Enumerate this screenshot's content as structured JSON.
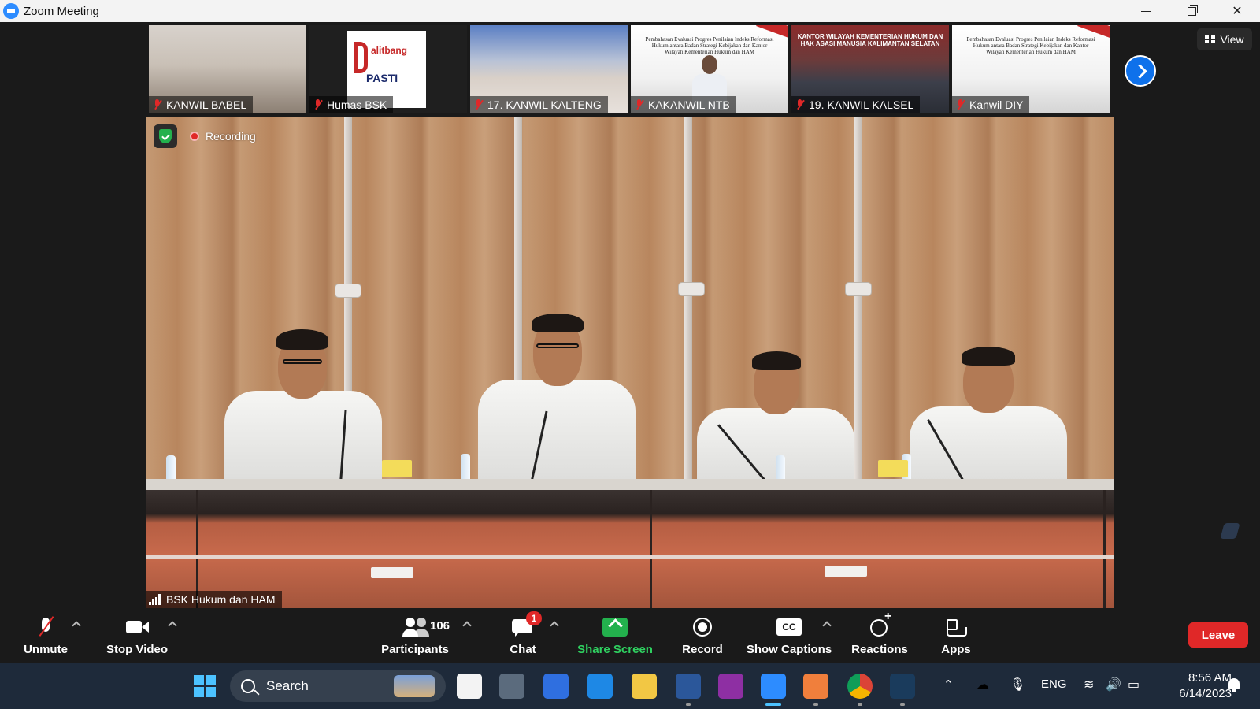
{
  "window": {
    "title": "Zoom Meeting",
    "controls": [
      "minimize",
      "restore",
      "close"
    ]
  },
  "top_bar": {
    "view_label": "View"
  },
  "gallery_strip": {
    "tiles": [
      {
        "name": "KANWIL BABEL",
        "muted": true
      },
      {
        "name": "Humas BSK",
        "muted": true
      },
      {
        "name": "17. KANWIL KALTENG",
        "muted": true
      },
      {
        "name": "KAKANWIL NTB",
        "muted": true
      },
      {
        "name": "19. KANWIL KALSEL",
        "muted": true
      },
      {
        "name": "Kanwil DIY",
        "muted": true
      }
    ],
    "logo_tile": {
      "line1": "alitbang",
      "line2": "PASTI"
    },
    "slide_text": "Pembahasan Evaluasi Progres Penilaian Indeks Reformasi Hukum antara Badan Strategi Kebijakan dan Kantor Wilayah Kementerian Hukum dan HAM",
    "office_text": "KANTOR WILAYAH KEMENTERIAN HUKUM DAN HAK ASASI MANUSIA KALIMANTAN SELATAN"
  },
  "main_video": {
    "speaker_name": "BSK Hukum dan HAM",
    "recording_label": "Recording"
  },
  "controls": {
    "unmute": "Unmute",
    "stop_video": "Stop Video",
    "participants": "Participants",
    "participant_count": "106",
    "chat": "Chat",
    "chat_badge": "1",
    "share_screen": "Share Screen",
    "record": "Record",
    "show_captions": "Show Captions",
    "reactions": "Reactions",
    "apps": "Apps",
    "leave": "Leave"
  },
  "taskbar": {
    "search_placeholder": "Search",
    "language": "ENG",
    "time": "8:56 AM",
    "date": "6/14/2023"
  },
  "colors": {
    "accent_blue": "#0e71eb",
    "share_green": "#23b14d",
    "leave_red": "#e02828",
    "muted_red": "#e02828"
  }
}
